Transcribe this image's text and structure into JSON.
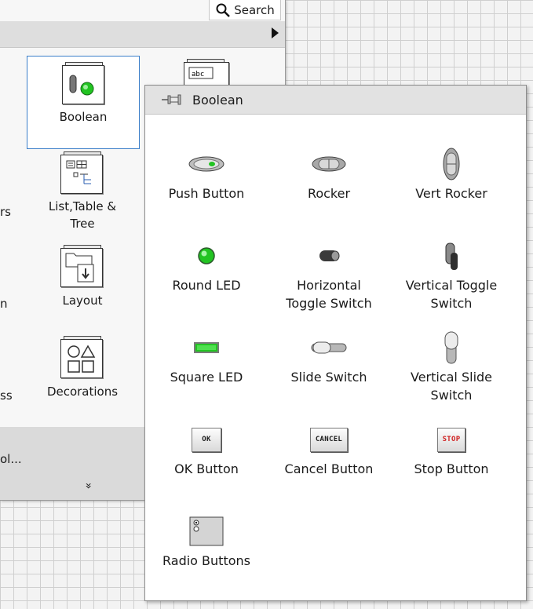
{
  "search": {
    "label": "Search"
  },
  "back_palette": {
    "tiles": [
      {
        "label": "Boolean"
      },
      {
        "label": "List,Table &"
      },
      {
        "label": "Tree"
      },
      {
        "label": "Layout"
      },
      {
        "label": "Decorations"
      }
    ],
    "partial_labels": [
      "rs",
      "n",
      "ss",
      "ol..."
    ],
    "expand_glyph": "»"
  },
  "popup": {
    "title": "Boolean",
    "items": [
      {
        "label": "Push Button",
        "label2": ""
      },
      {
        "label": "Rocker",
        "label2": ""
      },
      {
        "label": "Vert Rocker",
        "label2": ""
      },
      {
        "label": "Round LED",
        "label2": ""
      },
      {
        "label": "Horizontal",
        "label2": "Toggle Switch"
      },
      {
        "label": "Vertical Toggle",
        "label2": "Switch"
      },
      {
        "label": "Square LED",
        "label2": ""
      },
      {
        "label": "Slide Switch",
        "label2": ""
      },
      {
        "label": "Vertical Slide",
        "label2": "Switch"
      },
      {
        "label": "OK Button",
        "label2": "",
        "icon_text": "OK"
      },
      {
        "label": "Cancel Button",
        "label2": "",
        "icon_text": "CANCEL"
      },
      {
        "label": "Stop Button",
        "label2": "",
        "icon_text": "STOP"
      },
      {
        "label": "Radio Buttons",
        "label2": ""
      }
    ]
  },
  "colors": {
    "led_green": "#22c422",
    "stop_red": "#d02020",
    "selection_blue": "#3a7ec9"
  }
}
